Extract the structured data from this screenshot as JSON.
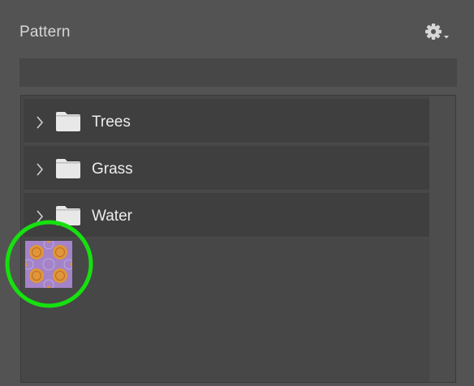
{
  "panel": {
    "title": "Pattern"
  },
  "toolbar": {
    "settings_icon": "gear-icon",
    "dropdown_icon": "caret-down-icon"
  },
  "groups": [
    {
      "label": "Trees",
      "icon": "folder-icon"
    },
    {
      "label": "Grass",
      "icon": "folder-icon"
    },
    {
      "label": "Water",
      "icon": "folder-icon"
    }
  ],
  "swatch": {
    "background_color": "#a483c8",
    "accent_color": "#e0963a"
  },
  "annotation": {
    "highlight_color": "#16e00f"
  }
}
